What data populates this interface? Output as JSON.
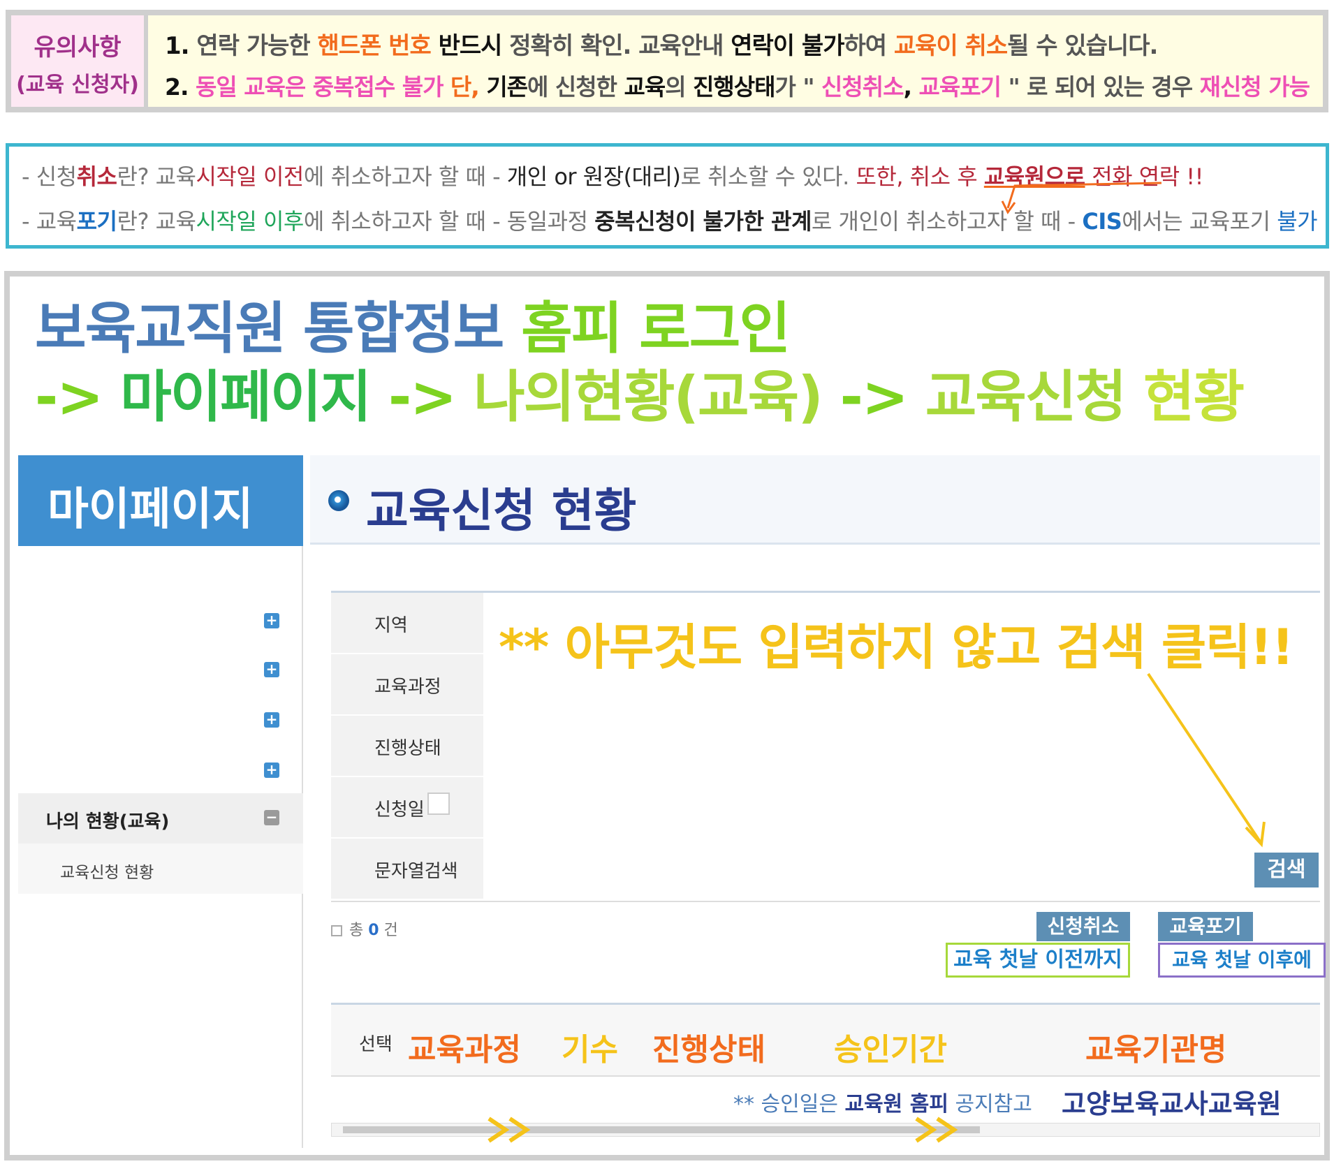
{
  "notice": {
    "label_line1": "유의사항",
    "label_line2": "(교육 신청자)",
    "line1": {
      "num": "1.",
      "t1": "연락 가능한 ",
      "t2": "핸드폰 번호",
      "t3": " 반드시",
      "t4": " 정확히 확인. 교육안내 ",
      "t5": "연락이 불가",
      "t6": "하여 ",
      "t7": "교육이 취소",
      "t8": "될 수 있습니다."
    },
    "line2": {
      "num": "2.",
      "t1": "동일 교육은 중복접수 불가",
      "t2": " 단,",
      "t3": " 기존",
      "t4": "에 신청한 ",
      "t5": "교육",
      "t6": "의 ",
      "t7": "진행상태",
      "t8": "가 \" ",
      "t9": "신청취소",
      "t10": ", ",
      "t11": "교육포기",
      "t12": " \" 로 되어 있는 경우 ",
      "t13": "재신청 가능"
    }
  },
  "defs": {
    "line1": {
      "t1": "- 신청",
      "t2": "취소",
      "t3": "란? 교육",
      "t4": "시작일 이전",
      "t5": "에 취소하고자 할 때 - ",
      "t6": "개인 or 원장(대리)",
      "t7": "로 취소할 수 있다. ",
      "t8": "또한, 취소 후 ",
      "t9": "교육원으로",
      "t10": " 전화 연락 !!"
    },
    "line2": {
      "t1": "- 교육",
      "t2": "포기",
      "t3": "란? 교육",
      "t4": "시작일 이후",
      "t5": "에 취소하고자 할 때 - 동일과정 ",
      "t6": "중복신청이 불가한 관계",
      "t7": "로 개인이 취소하고자 할 때 - ",
      "t8": "CIS",
      "t9": "에서는 교육포기 ",
      "t10": "불가"
    }
  },
  "headline": {
    "part1": "보육교직원 통합정보 ",
    "part2": "홈피 로그인",
    "path1": "-> ",
    "path2": "마이페이지",
    "path3": " -> ",
    "path4": "나의현황(교육)",
    "path5": " -> ",
    "path6": "교육신청",
    "path7": " 현황"
  },
  "sidebar": {
    "title": "마이페이지",
    "active_item": "나의 현황(교육)",
    "sub_item": "교육신청 현황",
    "minus_glyph": "−",
    "plus_glyph": "+"
  },
  "content": {
    "title": "교육신청 현황"
  },
  "form": {
    "fields": [
      "지역",
      "교육과정",
      "진행상태",
      "신청일",
      "문자열검색"
    ],
    "search_button": "검색",
    "hint": "** 아무것도 입력하지 않고 검색 클릭!!"
  },
  "results": {
    "total_prefix": "총 ",
    "total_count": "0",
    "total_suffix": " 건",
    "cancel_button": "신청취소",
    "cancel_note": "교육 첫날 이전까지",
    "giveup_button": "교육포기",
    "giveup_note": "교육 첫날 이후에"
  },
  "table": {
    "headers": [
      "선택",
      "교육과정",
      "기수",
      "진행상태",
      "승인기간",
      "교육기관명"
    ],
    "row_note_prefix": "** 승인일은 ",
    "row_note_bold": "교육원 홈피",
    "row_note_suffix": " 공지참고",
    "institution": "고양보육교사교육원"
  },
  "colors": {
    "orange": "#f26b1d",
    "pink": "#ee4fb5",
    "green": "#7ed321",
    "yellow": "#f5c31a",
    "blue_title": "#2a3d8f",
    "sidebar_blue": "#3f8fd0",
    "cyan_border": "#3db6cf"
  }
}
